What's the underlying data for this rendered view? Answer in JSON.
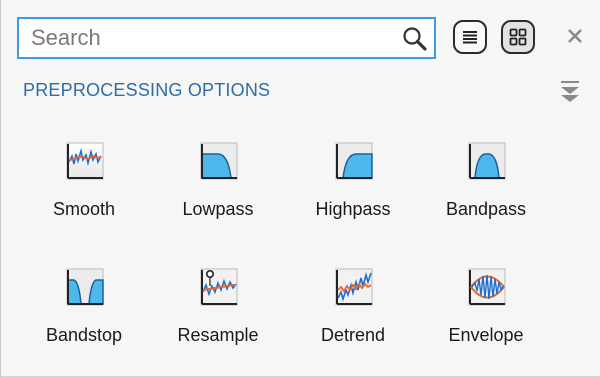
{
  "search": {
    "placeholder": "Search",
    "value": ""
  },
  "view_buttons": {
    "list_icon": "list-view-icon",
    "grid_icon": "grid-view-icon",
    "selected": "grid"
  },
  "close_icon": "close-icon",
  "section": {
    "title": "PREPROCESSING OPTIONS",
    "collapse_icon": "collapse-icon"
  },
  "colors": {
    "accent": "#3f9be0",
    "section_title": "#2f6da4",
    "filter_fill": "#4cb8ec",
    "signal_blue": "#1f6fd0",
    "signal_orange": "#e8672a"
  },
  "options": [
    {
      "label": "Smooth",
      "icon": "smooth-icon"
    },
    {
      "label": "Lowpass",
      "icon": "lowpass-icon"
    },
    {
      "label": "Highpass",
      "icon": "highpass-icon"
    },
    {
      "label": "Bandpass",
      "icon": "bandpass-icon"
    },
    {
      "label": "Bandstop",
      "icon": "bandstop-icon"
    },
    {
      "label": "Resample",
      "icon": "resample-icon"
    },
    {
      "label": "Detrend",
      "icon": "detrend-icon"
    },
    {
      "label": "Envelope",
      "icon": "envelope-icon"
    }
  ]
}
